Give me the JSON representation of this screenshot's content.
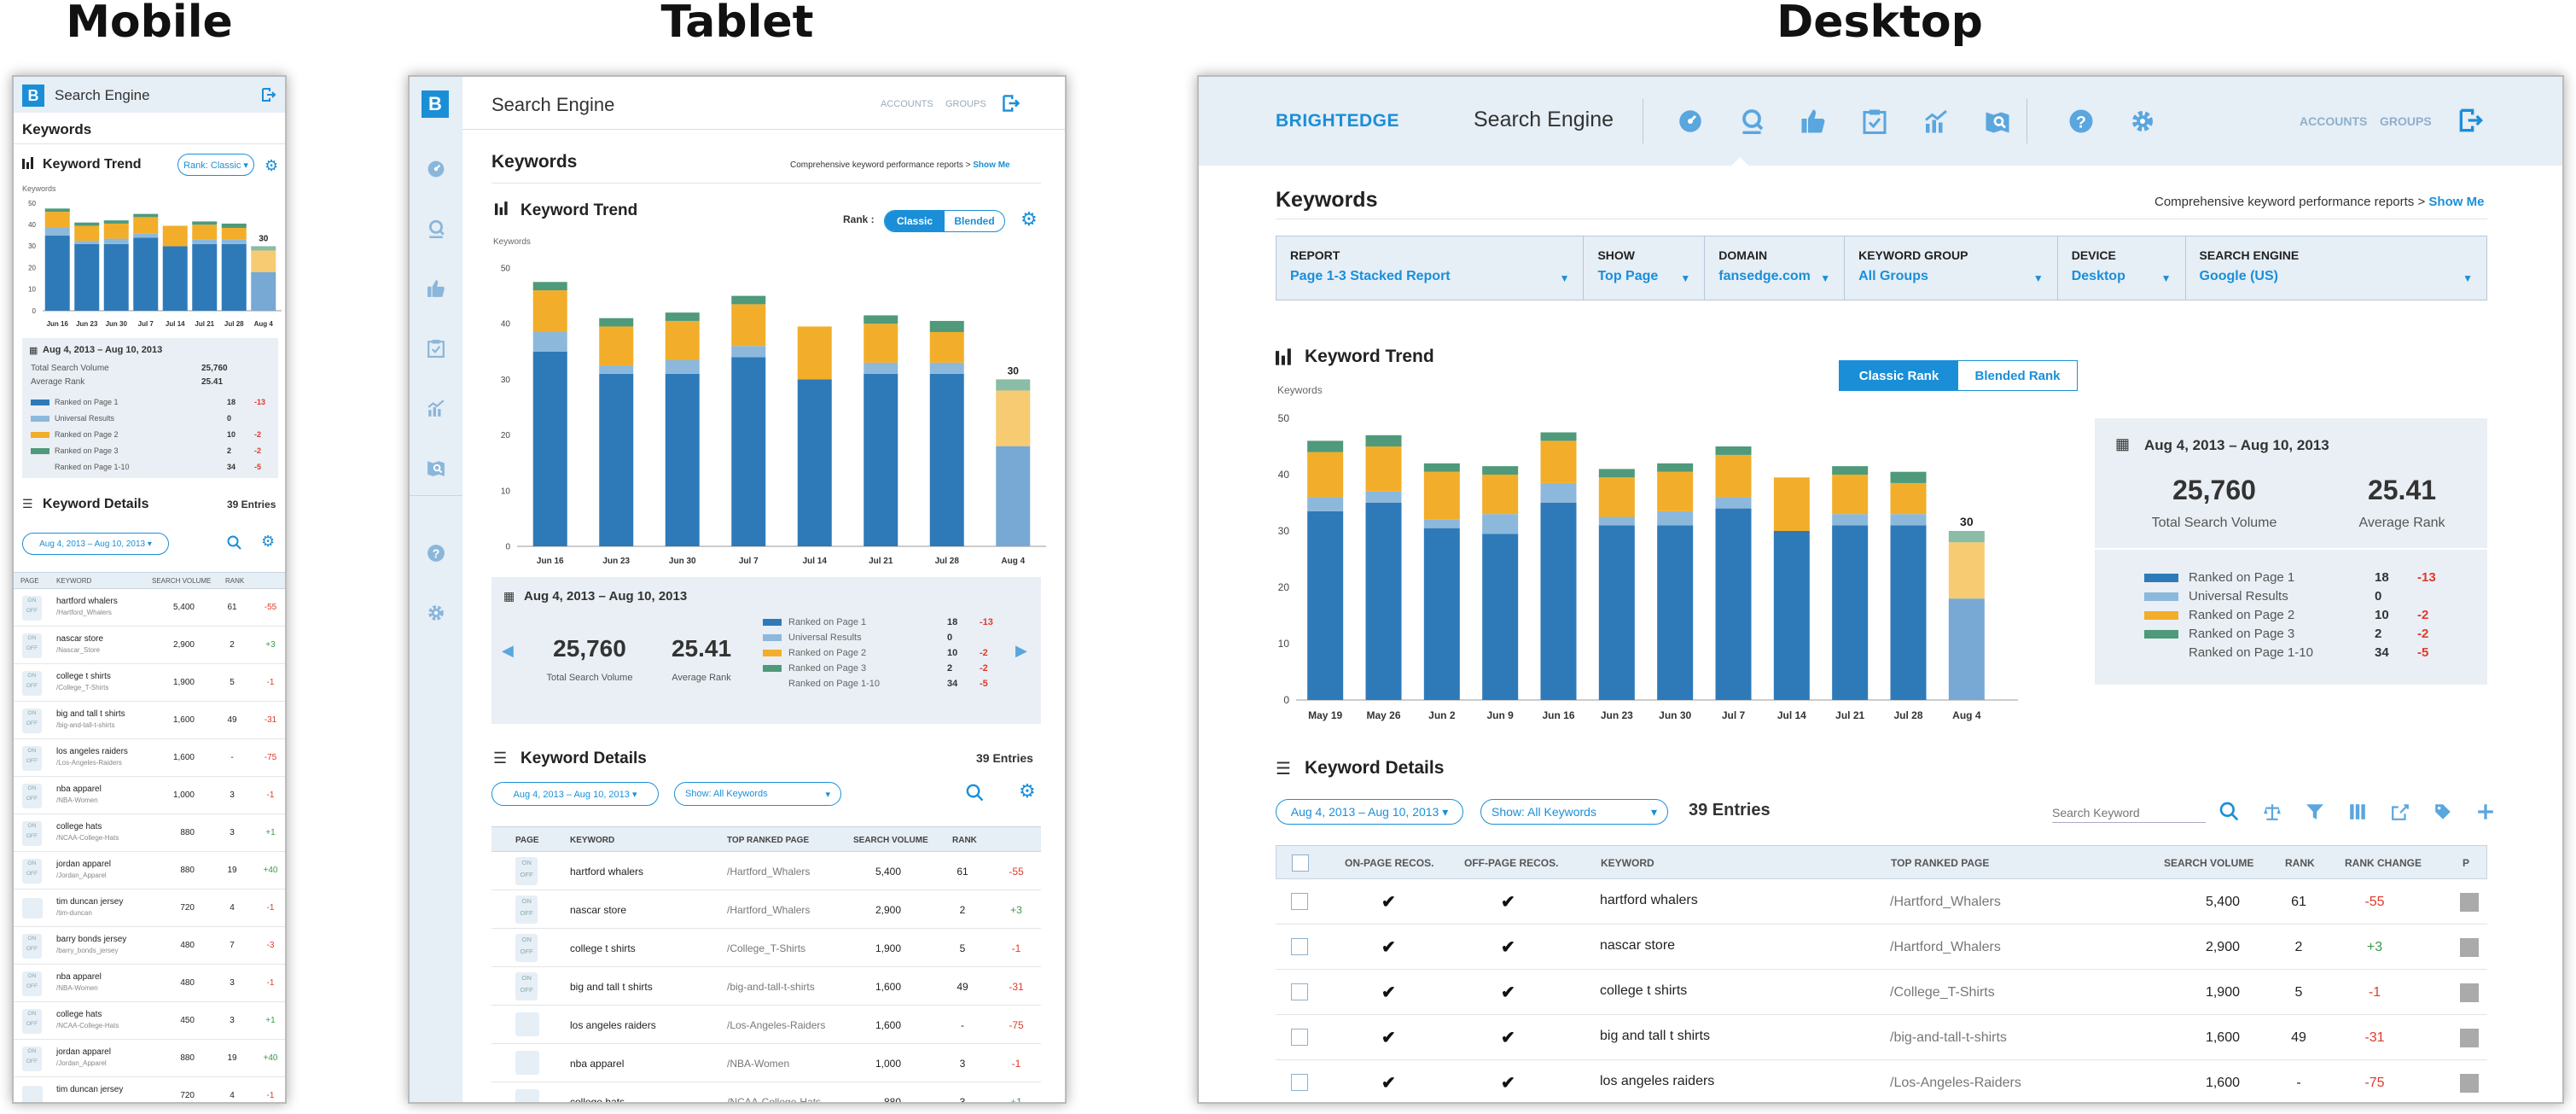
{
  "labels": {
    "mobile": "Mobile",
    "tablet": "Tablet",
    "desktop": "Desktop"
  },
  "app": {
    "logo_letter": "B",
    "brand": "BRIGHTEDGE",
    "title": "Search Engine",
    "accounts": "ACCOUNTS",
    "groups": "GROUPS",
    "page_title": "Keywords",
    "report_desc": "Comprehensive keyword performance reports >",
    "show_me": "Show Me"
  },
  "filters": [
    {
      "label": "REPORT",
      "value": "Page 1-3 Stacked Report"
    },
    {
      "label": "SHOW",
      "value": "Top Page"
    },
    {
      "label": "DOMAIN",
      "value": "fansedge.com"
    },
    {
      "label": "KEYWORD GROUP",
      "value": "All Groups"
    },
    {
      "label": "DEVICE",
      "value": "Desktop"
    },
    {
      "label": "SEARCH ENGINE",
      "value": "Google (US)"
    }
  ],
  "trend": {
    "title": "Keyword Trend",
    "rank_label": "Rank :",
    "classic": "Classic",
    "blended": "Blended",
    "classic_rank": "Classic Rank",
    "blended_rank": "Blended Rank",
    "mobile_rank": "Rank: Classic",
    "ylabel": "Keywords"
  },
  "chart_data": [
    {
      "type": "bar",
      "stacked": true,
      "ylabel": "Keywords",
      "ylim": [
        0,
        50
      ],
      "yticks": [
        "0",
        "10",
        "20",
        "30",
        "40",
        "50"
      ],
      "categories": [
        "May 19",
        "May 26",
        "Jun 2",
        "Jun 9",
        "Jun 16",
        "Jun 23",
        "Jun 30",
        "Jul 7",
        "Jul 14",
        "Jul 21",
        "Jul 28",
        "Aug 4"
      ],
      "series": [
        {
          "name": "Ranked on Page 1",
          "color": "#2e7ab8",
          "values": [
            33.5,
            35,
            30.5,
            29.5,
            35,
            31,
            31,
            34,
            30,
            31,
            31,
            18
          ]
        },
        {
          "name": "Universal Results",
          "color": "#8cb8dc",
          "values": [
            2.5,
            2,
            1.5,
            3.5,
            3.5,
            1.5,
            2.5,
            2,
            0,
            2,
            2,
            0
          ]
        },
        {
          "name": "Ranked on Page 2",
          "color": "#f2ae2a",
          "values": [
            8,
            8,
            8.5,
            7,
            7.5,
            7,
            7,
            7.5,
            9.5,
            7,
            5.5,
            10
          ]
        },
        {
          "name": "Ranked on Page 3",
          "color": "#4e9a7a",
          "values": [
            2,
            2,
            1.5,
            1.5,
            1.5,
            1.5,
            1.5,
            1.5,
            0,
            1.5,
            2,
            2
          ]
        }
      ],
      "highlight_total": "30",
      "highlight_colors": [
        "#78a8d4",
        "#c0d8ec",
        "#f6cb72",
        "#8abca6"
      ]
    }
  ],
  "summary": {
    "date_range": "Aug 4, 2013 – Aug 10, 2013",
    "total_volume": "25,760",
    "total_volume_label": "Total Search Volume",
    "avg_rank": "25.41",
    "avg_rank_label": "Average Rank",
    "legend": [
      {
        "name": "Ranked on Page 1",
        "value": "18",
        "change": "-13",
        "color": "#2e7ab8"
      },
      {
        "name": "Universal Results",
        "value": "0",
        "change": "",
        "color": "#8cb8dc"
      },
      {
        "name": "Ranked on Page 2",
        "value": "10",
        "change": "-2",
        "color": "#f2ae2a"
      },
      {
        "name": "Ranked on Page 3",
        "value": "2",
        "change": "-2",
        "color": "#4e9a7a"
      },
      {
        "name": "Ranked on Page 1-10",
        "value": "34",
        "change": "-5",
        "color": ""
      }
    ]
  },
  "details": {
    "title": "Keyword Details",
    "entries": "39 Entries",
    "date_filter": "Aug 4, 2013 – Aug 10, 2013",
    "show_filter": "Show: All Keywords",
    "search_placeholder": "Search Keyword",
    "headers": {
      "page": "PAGE",
      "keyword": "KEYWORD",
      "top_page": "TOP RANKED PAGE",
      "volume": "SEARCH VOLUME",
      "rank": "RANK",
      "rank_change": "RANK CHANGE",
      "p": "P",
      "on_page": "ON-PAGE RECOS.",
      "off_page": "OFF-PAGE RECOS."
    },
    "on": "ON",
    "off": "OFF"
  },
  "rows": [
    {
      "keyword": "hartford whalers",
      "mobile_page": "/Hartford_Whalers",
      "page": "/Hartford_Whalers",
      "volume": "5,400",
      "rank": "61",
      "change": "-55"
    },
    {
      "keyword": "nascar store",
      "mobile_page": "/Nascar_Store",
      "page": "/Hartford_Whalers",
      "volume": "2,900",
      "rank": "2",
      "change": "+3"
    },
    {
      "keyword": "college t shirts",
      "mobile_page": "/College_T-Shirts",
      "page": "/College_T-Shirts",
      "volume": "1,900",
      "rank": "5",
      "change": "-1"
    },
    {
      "keyword": "big and tall t shirts",
      "mobile_page": "/big-and-tall-t-shirts",
      "page": "/big-and-tall-t-shirts",
      "volume": "1,600",
      "rank": "49",
      "change": "-31"
    },
    {
      "keyword": "los angeles raiders",
      "mobile_page": "/Los-Angeles-Raiders",
      "page": "/Los-Angeles-Raiders",
      "volume": "1,600",
      "rank": "-",
      "change": "-75"
    },
    {
      "keyword": "nba apparel",
      "mobile_page": "/NBA-Women",
      "page": "/NBA-Women",
      "volume": "1,000",
      "rank": "3",
      "change": "-1"
    },
    {
      "keyword": "college hats",
      "mobile_page": "/NCAA-College-Hats",
      "page": "/NCAA-College-Hats",
      "volume": "880",
      "rank": "3",
      "change": "+1"
    },
    {
      "keyword": "jordan apparel",
      "mobile_page": "/Jordan_Apparel",
      "page": "",
      "volume": "880",
      "rank": "19",
      "change": "+40"
    },
    {
      "keyword": "tim duncan jersey",
      "mobile_page": "/tim-duncan",
      "page": "",
      "volume": "720",
      "rank": "4",
      "change": "-1"
    },
    {
      "keyword": "barry bonds jersey",
      "mobile_page": "/barry_bonds_jersey",
      "page": "",
      "volume": "480",
      "rank": "7",
      "change": "-3"
    },
    {
      "keyword": "nba apparel",
      "mobile_page": "/NBA-Women",
      "page": "",
      "volume": "480",
      "rank": "3",
      "change": "-1"
    },
    {
      "keyword": "college hats",
      "mobile_page": "/NCAA-College-Hats",
      "page": "",
      "volume": "450",
      "rank": "3",
      "change": "+1"
    },
    {
      "keyword": "jordan apparel",
      "mobile_page": "/Jordan_Apparel",
      "page": "",
      "volume": "880",
      "rank": "19",
      "change": "+40"
    },
    {
      "keyword": "tim duncan jersey",
      "mobile_page": "",
      "page": "",
      "volume": "720",
      "rank": "4",
      "change": "-1"
    }
  ],
  "colors": {
    "accent": "#1a8fd8",
    "header_bg": "#e6eef6",
    "panel_bg": "#e9eff5",
    "negative": "#e0392b",
    "positive": "#3a9a4a"
  },
  "icons": [
    "dashboard-icon",
    "search-engine-icon",
    "thumbs-up-icon",
    "checklist-icon",
    "growth-chart-icon",
    "map-search-icon",
    "help-icon",
    "gear-icon",
    "logout-icon",
    "calendar-icon",
    "bar-chart-icon",
    "list-icon",
    "search-icon",
    "balance-icon",
    "filter-icon",
    "columns-icon",
    "export-icon",
    "tag-icon",
    "plus-icon"
  ]
}
